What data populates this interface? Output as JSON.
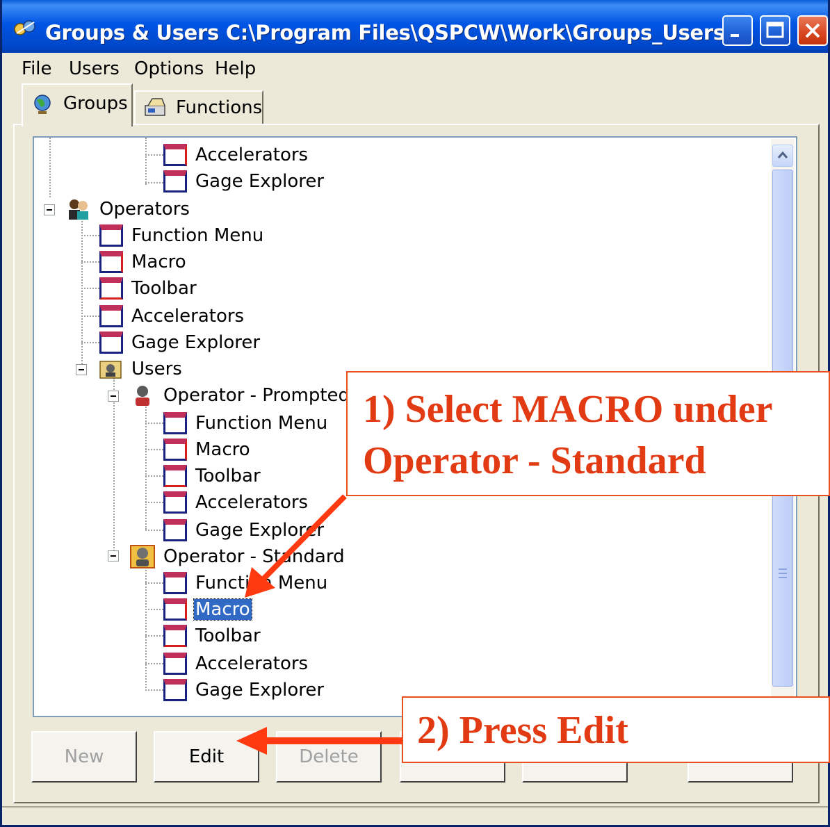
{
  "window": {
    "title": "Groups & Users C:\\Program Files\\QSPCW\\Work\\Groups_Users....",
    "controls": [
      "minimize-icon",
      "maximize-icon",
      "close-icon"
    ]
  },
  "menu": {
    "file": "File",
    "users": "Users",
    "options": "Options",
    "help": "Help"
  },
  "tabs": {
    "groups": "Groups",
    "functions": "Functions"
  },
  "tree": {
    "rows": [
      {
        "label": "Accelerators",
        "type": "doc"
      },
      {
        "label": "Gage Explorer",
        "type": "doc"
      },
      {
        "label": "Operators",
        "type": "group"
      },
      {
        "label": "Function Menu",
        "type": "doc"
      },
      {
        "label": "Macro",
        "type": "doc"
      },
      {
        "label": "Toolbar",
        "type": "doc"
      },
      {
        "label": "Accelerators",
        "type": "doc"
      },
      {
        "label": "Gage Explorer",
        "type": "doc"
      },
      {
        "label": "Users",
        "type": "users"
      },
      {
        "label": "Operator - Prompted",
        "type": "user"
      },
      {
        "label": "Function Menu",
        "type": "doc"
      },
      {
        "label": "Macro",
        "type": "doc"
      },
      {
        "label": "Toolbar",
        "type": "doc"
      },
      {
        "label": "Accelerators",
        "type": "doc"
      },
      {
        "label": "Gage Explorer",
        "type": "doc"
      },
      {
        "label": "Operator - Standard",
        "type": "user"
      },
      {
        "label": "Function Menu",
        "type": "doc"
      },
      {
        "label": "Macro",
        "type": "doc",
        "selected": true
      },
      {
        "label": "Toolbar",
        "type": "doc"
      },
      {
        "label": "Accelerators",
        "type": "doc"
      },
      {
        "label": "Gage Explorer",
        "type": "doc"
      }
    ]
  },
  "buttons": {
    "new": "New",
    "edit": "Edit",
    "delete": "Delete"
  },
  "callouts": {
    "step1_line1": "1) Select MACRO under",
    "step1_line2": "Operator - Standard",
    "step2": "2) Press Edit"
  },
  "colors": {
    "title_bar": "#0055E5",
    "selection": "#316AC5",
    "callout_text": "#E23A12",
    "callout_border": "#E8501E"
  }
}
